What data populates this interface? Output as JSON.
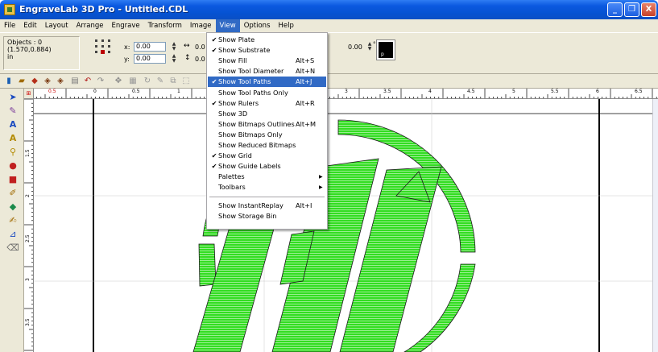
{
  "window": {
    "title": "EngraveLab 3D Pro - Untitled.CDL",
    "min_symbol": "_",
    "max_symbol": "❐",
    "close_symbol": "X"
  },
  "menubar": {
    "items": [
      "File",
      "Edit",
      "Layout",
      "Arrange",
      "Engrave",
      "Transform",
      "Image",
      "View",
      "Options",
      "Help"
    ],
    "active_index": 7
  },
  "properties": {
    "objects_label": "Objects : 0",
    "coords": "(1.570,0.884)",
    "units": "in",
    "x_label": "x:",
    "x_value": "0.00",
    "y_label": "y:",
    "y_value": "0.00",
    "width_value": "0.0",
    "height_value": "0.0",
    "extra_value": "0.00",
    "degree_symbol": "°",
    "swatch_label": "p"
  },
  "ruler": {
    "top_labels": [
      "0.5",
      "0",
      "0.5",
      "1",
      "3",
      "3.5",
      "4",
      "4.5",
      "5",
      "5.5",
      "6",
      "6.5"
    ],
    "left_labels": [
      "1.5",
      "2",
      "2.5",
      "3",
      "3.5"
    ]
  },
  "view_menu": {
    "items": [
      {
        "label": "Show Plate",
        "checked": true,
        "accel": "",
        "submenu": false
      },
      {
        "label": "Show Substrate",
        "checked": true,
        "accel": "",
        "submenu": false
      },
      {
        "label": "Show Fill",
        "checked": false,
        "accel": "Alt+S",
        "submenu": false
      },
      {
        "label": "Show Tool Diameter",
        "checked": false,
        "accel": "Alt+N",
        "submenu": false
      },
      {
        "label": "Show Tool Paths",
        "checked": true,
        "accel": "Alt+J",
        "submenu": false,
        "highlighted": true
      },
      {
        "label": "Show Tool Paths Only",
        "checked": false,
        "accel": "",
        "submenu": false
      },
      {
        "label": "Show Rulers",
        "checked": true,
        "accel": "Alt+R",
        "submenu": false
      },
      {
        "label": "Show 3D",
        "checked": false,
        "accel": "",
        "submenu": false
      },
      {
        "label": "Show Bitmaps Outlines",
        "checked": false,
        "accel": "Alt+M",
        "submenu": false
      },
      {
        "label": "Show Bitmaps Only",
        "checked": false,
        "accel": "",
        "submenu": false
      },
      {
        "label": "Show Reduced Bitmaps",
        "checked": false,
        "accel": "",
        "submenu": false
      },
      {
        "label": "Show Grid",
        "checked": true,
        "accel": "",
        "submenu": false
      },
      {
        "label": "Show Guide Labels",
        "checked": true,
        "accel": "",
        "submenu": false
      },
      {
        "label": "Palettes",
        "checked": false,
        "accel": "",
        "submenu": true
      },
      {
        "label": "Toolbars",
        "checked": false,
        "accel": "",
        "submenu": true
      },
      {
        "label": "Show InstantReplay",
        "checked": false,
        "accel": "Alt+I",
        "submenu": false,
        "separator_before": true
      },
      {
        "label": "Show Storage Bin",
        "checked": false,
        "accel": "",
        "submenu": false
      }
    ],
    "check_glyph": "✔",
    "arrow_glyph": "▶"
  },
  "colors": {
    "menu_highlight": "#316ac5",
    "artwork_green": "#33dd22",
    "titlebar_blue": "#0552d2"
  }
}
